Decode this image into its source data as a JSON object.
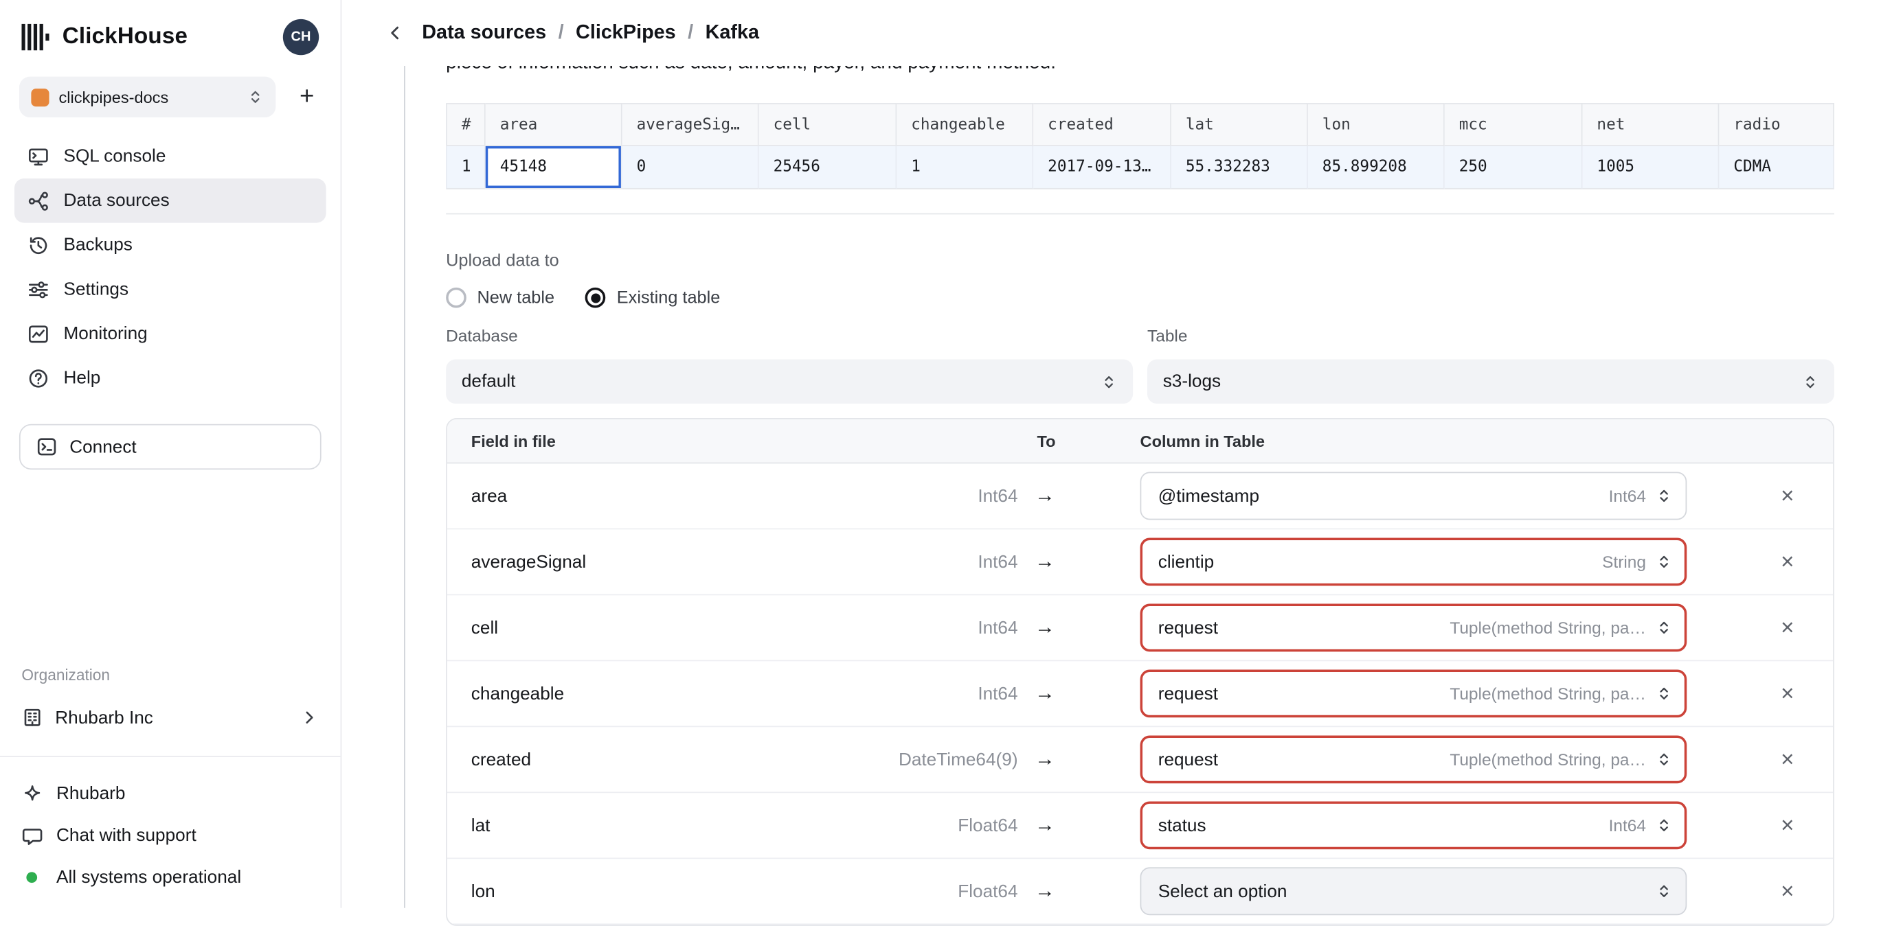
{
  "colors": {
    "accent_blue": "#3268d6",
    "error_red": "#cc4339",
    "success_green": "#2eae4f",
    "selected_row_bg": "#f1f6fd"
  },
  "sidebar": {
    "brand": "ClickHouse",
    "avatar": "CH",
    "workspace": {
      "name": "clickpipes-docs",
      "icon": "workspace-logo-icon"
    },
    "add_label": "+",
    "nav": [
      {
        "label": "SQL console",
        "icon": "terminal-icon",
        "active": false
      },
      {
        "label": "Data sources",
        "icon": "data-sources-icon",
        "active": true
      },
      {
        "label": "Backups",
        "icon": "backups-icon",
        "active": false
      },
      {
        "label": "Settings",
        "icon": "settings-icon",
        "active": false
      },
      {
        "label": "Monitoring",
        "icon": "monitoring-icon",
        "active": false
      },
      {
        "label": "Help",
        "icon": "help-icon",
        "active": false
      }
    ],
    "connect_label": "Connect",
    "organization_label": "Organization",
    "organization_name": "Rhubarb Inc",
    "footer": [
      {
        "label": "Rhubarb",
        "icon": "sparkle-icon"
      },
      {
        "label": "Chat with support",
        "icon": "chat-icon"
      },
      {
        "label": "All systems operational",
        "icon": "status-dot"
      }
    ]
  },
  "header": {
    "breadcrumb": [
      "Data sources",
      "ClickPipes",
      "Kafka"
    ]
  },
  "content": {
    "clipped_text": "piece of information such as date, amount, payer, and payment method.",
    "preview_table": {
      "columns": [
        "#",
        "area",
        "averageSig…",
        "cell",
        "changeable",
        "created",
        "lat",
        "lon",
        "mcc",
        "net",
        "radio"
      ],
      "row": [
        "1",
        "45148",
        "0",
        "25456",
        "1",
        "2017-09-13…",
        "55.332283",
        "85.899208",
        "250",
        "1005",
        "CDMA"
      ]
    },
    "upload": {
      "label": "Upload data to",
      "options": [
        {
          "label": "New table",
          "selected": false
        },
        {
          "label": "Existing table",
          "selected": true
        }
      ],
      "database_label": "Database",
      "database_value": "default",
      "table_label": "Table",
      "table_value": "s3-logs"
    },
    "mapping": {
      "headers": [
        "Field in file",
        "To",
        "Column in Table"
      ],
      "rows": [
        {
          "field": "area",
          "type": "Int64",
          "column": "@timestamp",
          "column_type": "Int64",
          "state": "normal"
        },
        {
          "field": "averageSignal",
          "type": "Int64",
          "column": "clientip",
          "column_type": "String",
          "state": "error"
        },
        {
          "field": "cell",
          "type": "Int64",
          "column": "request",
          "column_type": "Tuple(method String, pa…",
          "state": "error"
        },
        {
          "field": "changeable",
          "type": "Int64",
          "column": "request",
          "column_type": "Tuple(method String, pa…",
          "state": "error"
        },
        {
          "field": "created",
          "type": "DateTime64(9)",
          "column": "request",
          "column_type": "Tuple(method String, pa…",
          "state": "error"
        },
        {
          "field": "lat",
          "type": "Float64",
          "column": "status",
          "column_type": "Int64",
          "state": "error"
        },
        {
          "field": "lon",
          "type": "Float64",
          "column": "Select an option",
          "column_type": "",
          "state": "placeholder"
        }
      ]
    }
  }
}
